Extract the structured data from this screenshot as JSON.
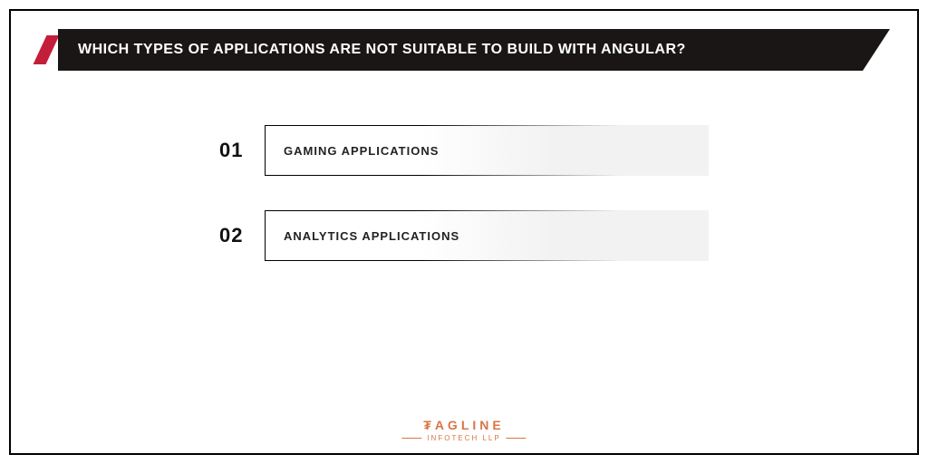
{
  "title": "WHICH TYPES OF APPLICATIONS ARE NOT SUITABLE TO BUILD WITH ANGULAR?",
  "items": [
    {
      "num": "01",
      "label": "GAMING APPLICATIONS"
    },
    {
      "num": "02",
      "label": "ANALYTICS APPLICATIONS"
    }
  ],
  "logo": {
    "top": "₮AGLINE",
    "bottom": "INFOTECH LLP"
  }
}
